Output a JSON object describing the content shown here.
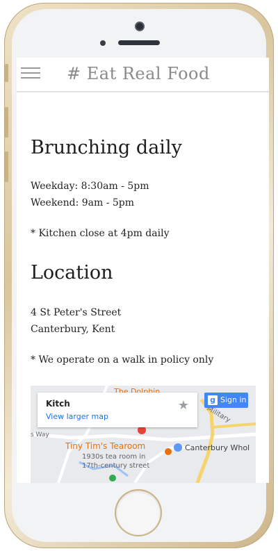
{
  "app": {
    "brand": "# Eat Real Food"
  },
  "hours": {
    "heading": "Brunching daily",
    "weekday": "Weekday: 8:30am - 5pm",
    "weekend": "Weekend: 9am - 5pm",
    "kitchen_note": "* Kitchen close at 4pm daily"
  },
  "location": {
    "heading": "Location",
    "address_line1": "4 St Peter's Street",
    "address_line2": "Canterbury, Kent",
    "policy_note": "* We operate on a walk in policy only"
  },
  "map": {
    "card_title": "Kitch",
    "card_link": "View larger map",
    "signin_label": "Sign in",
    "labels": {
      "dolphin": "The Dolphin",
      "military": "Military",
      "way": "s Way",
      "tearoom_name": "Tiny Tim's Tearoom",
      "tearoom_desc1": "1930s tea room in",
      "tearoom_desc2": "17th-century street",
      "canterbury": "Canterbury Whol"
    }
  },
  "colors": {
    "accent_link": "#1a73e8",
    "signin_bg": "#4285f4",
    "map_poi": "#e8710a"
  }
}
